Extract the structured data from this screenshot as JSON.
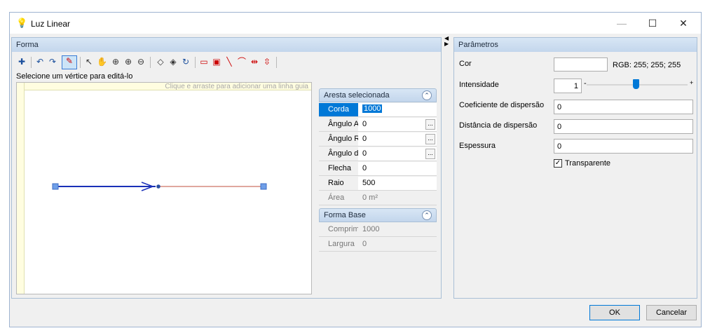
{
  "window": {
    "title": "Luz Linear"
  },
  "forma": {
    "header": "Forma",
    "hint": "Selecione um vértice para editá-lo",
    "guide_text": "Clique e arraste para adicionar uma linha guia"
  },
  "aresta": {
    "header": "Aresta selecionada",
    "rows": [
      {
        "label": "Corda",
        "value": "1000"
      },
      {
        "label": "Ângulo Ab",
        "value": "0"
      },
      {
        "label": "Ângulo Re",
        "value": "0"
      },
      {
        "label": "Ângulo do",
        "value": "0"
      },
      {
        "label": "Flecha",
        "value": "0"
      },
      {
        "label": "Raio",
        "value": "500"
      },
      {
        "label": "Área",
        "value": "0 m²"
      }
    ]
  },
  "forma_base": {
    "header": "Forma Base",
    "rows": [
      {
        "label": "Comprime",
        "value": "1000"
      },
      {
        "label": "Largura",
        "value": "0"
      }
    ]
  },
  "params": {
    "header": "Parâmetros",
    "cor_label": "Cor",
    "cor_rgb": "RGB: 255; 255; 255",
    "intensidade_label": "Intensidade",
    "intensidade_value": "1",
    "minus": "-",
    "plus": "+",
    "coef_label": "Coeficiente de dispersão",
    "coef_value": "0",
    "dist_label": "Distância de dispersão",
    "dist_value": "0",
    "esp_label": "Espessura",
    "esp_value": "0",
    "transparente_label": "Transparente"
  },
  "buttons": {
    "ok": "OK",
    "cancel": "Cancelar"
  }
}
